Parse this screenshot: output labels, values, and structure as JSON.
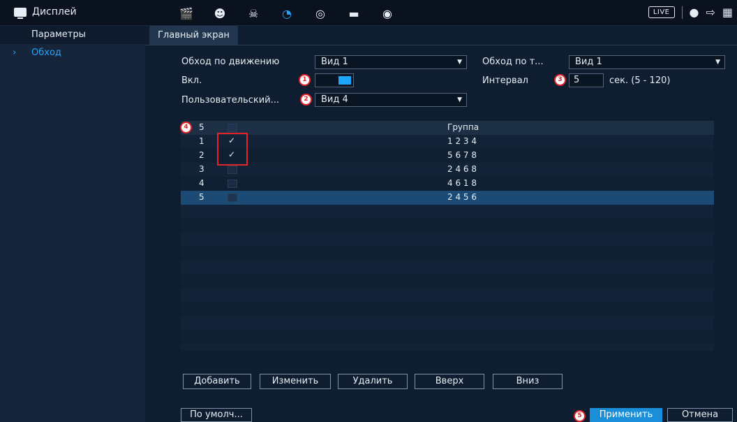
{
  "topbar": {
    "title": "Дисплей",
    "icons": [
      "film-icon",
      "face-icon",
      "alarm-icon",
      "dial-icon",
      "ring-icon",
      "monitor-icon",
      "speaker-icon"
    ],
    "live_label": "LIVE"
  },
  "sidebar": {
    "items": [
      {
        "label": "Параметры",
        "active": false
      },
      {
        "label": "Обход",
        "active": true
      }
    ]
  },
  "tabs": [
    {
      "label": "Главный экран"
    }
  ],
  "form": {
    "motion_tour_label": "Обход по движению",
    "motion_tour_value": "Вид 1",
    "tour_by_label": "Обход по т...",
    "tour_by_value": "Вид 1",
    "enable_label": "Вкл.",
    "interval_label": "Интервал",
    "interval_value": "5",
    "interval_unit": "сек. (5 - 120)",
    "custom_label": "Пользовательский...",
    "custom_value": "Вид 4"
  },
  "badges": [
    "1",
    "2",
    "3",
    "4",
    "5"
  ],
  "table": {
    "header": {
      "count": "5",
      "group_label": "Группа"
    },
    "rows": [
      {
        "num": "1",
        "checked": true,
        "group": "1 2 3 4"
      },
      {
        "num": "2",
        "checked": true,
        "group": "5 6 7 8"
      },
      {
        "num": "3",
        "checked": false,
        "group": "2 4 6 8"
      },
      {
        "num": "4",
        "checked": false,
        "group": "4 6 1 8"
      },
      {
        "num": "5",
        "checked": false,
        "group": "2 4 5 6"
      }
    ]
  },
  "buttons": {
    "add": "Добавить",
    "edit": "Изменить",
    "delete": "Удалить",
    "up": "Вверх",
    "down": "Вниз",
    "default": "По умолч...",
    "apply": "Применить",
    "cancel": "Отмена"
  },
  "colors": {
    "accent": "#1ea7ff",
    "badge_red": "#e2242a",
    "primary_button": "#1a8ed8"
  }
}
